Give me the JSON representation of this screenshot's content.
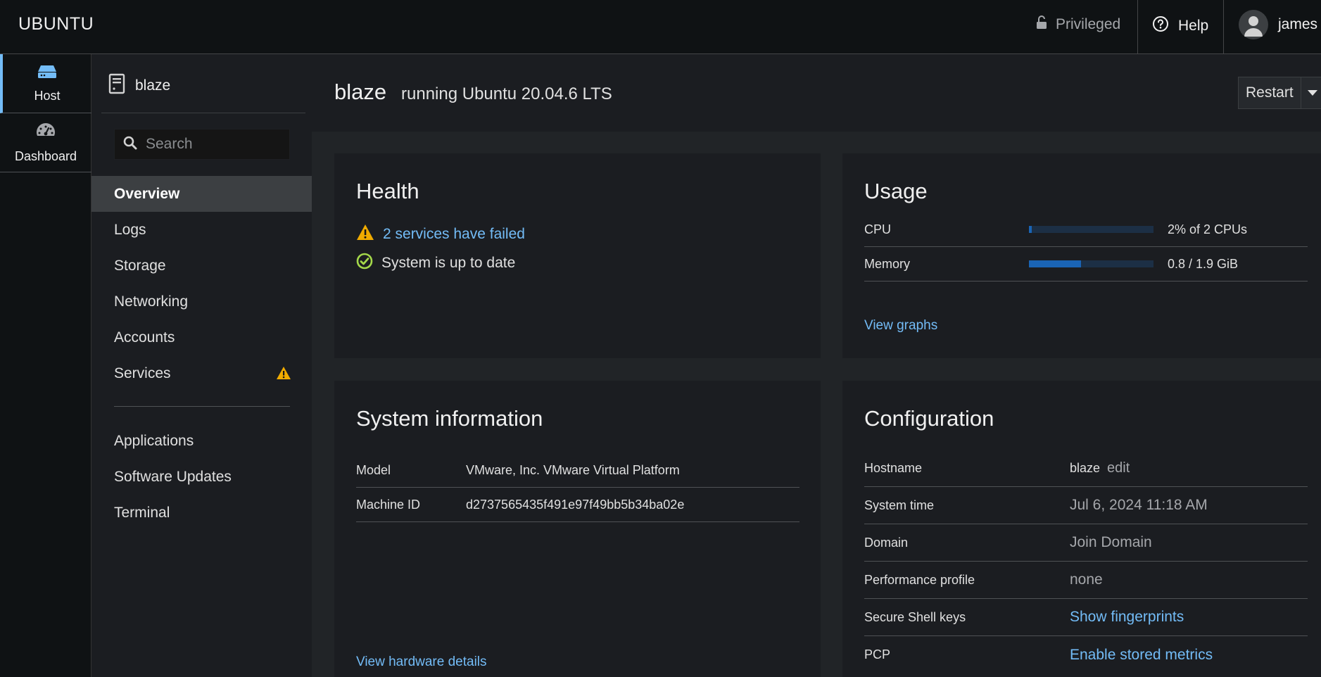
{
  "topbar": {
    "brand": "UBUNTU",
    "privileged_label": "Privileged",
    "help_label": "Help",
    "user_name": "james"
  },
  "rail": {
    "items": [
      {
        "label": "Host",
        "icon": "server-icon",
        "active": true
      },
      {
        "label": "Dashboard",
        "icon": "dashboard-gauge-icon",
        "active": false
      }
    ]
  },
  "nav": {
    "host_name": "blaze",
    "search_placeholder": "Search",
    "items": [
      {
        "label": "Overview",
        "active": true
      },
      {
        "label": "Logs"
      },
      {
        "label": "Storage"
      },
      {
        "label": "Networking"
      },
      {
        "label": "Accounts"
      },
      {
        "label": "Services",
        "badge": "warning-icon"
      },
      {
        "label": "Applications"
      },
      {
        "label": "Software Updates"
      },
      {
        "label": "Terminal"
      }
    ]
  },
  "header": {
    "host": "blaze",
    "subtitle": "running Ubuntu 20.04.6 LTS",
    "restart_label": "Restart"
  },
  "health": {
    "title": "Health",
    "failed_services": "2 services have failed",
    "update_status": "System is up to date"
  },
  "usage": {
    "title": "Usage",
    "rows": [
      {
        "label": "CPU",
        "value": "2% of 2 CPUs",
        "fraction": 0.02
      },
      {
        "label": "Memory",
        "value": "0.8 / 1.9 GiB",
        "fraction": 0.42
      }
    ],
    "view_graphs": "View graphs"
  },
  "sysinfo": {
    "title": "System information",
    "rows": [
      {
        "label": "Model",
        "value": "VMware, Inc. VMware Virtual Platform"
      },
      {
        "label": "Machine ID",
        "value": "d2737565435f491e97f49bb5b34ba02e"
      }
    ],
    "view_hardware": "View hardware details"
  },
  "config": {
    "title": "Configuration",
    "hostname_label": "Hostname",
    "hostname_value": "blaze",
    "hostname_edit": "edit",
    "systime_label": "System time",
    "systime_value": "Jul 6, 2024 11:18 AM",
    "domain_label": "Domain",
    "domain_value": "Join Domain",
    "perf_label": "Performance profile",
    "perf_value": "none",
    "ssh_label": "Secure Shell keys",
    "ssh_value": "Show fingerprints",
    "pcp_label": "PCP",
    "pcp_value": "Enable stored metrics"
  },
  "colors": {
    "link": "#73bcf7",
    "warning": "#f0ab00",
    "success": "#a4d84a",
    "bar_fill": "#1a64b5"
  }
}
